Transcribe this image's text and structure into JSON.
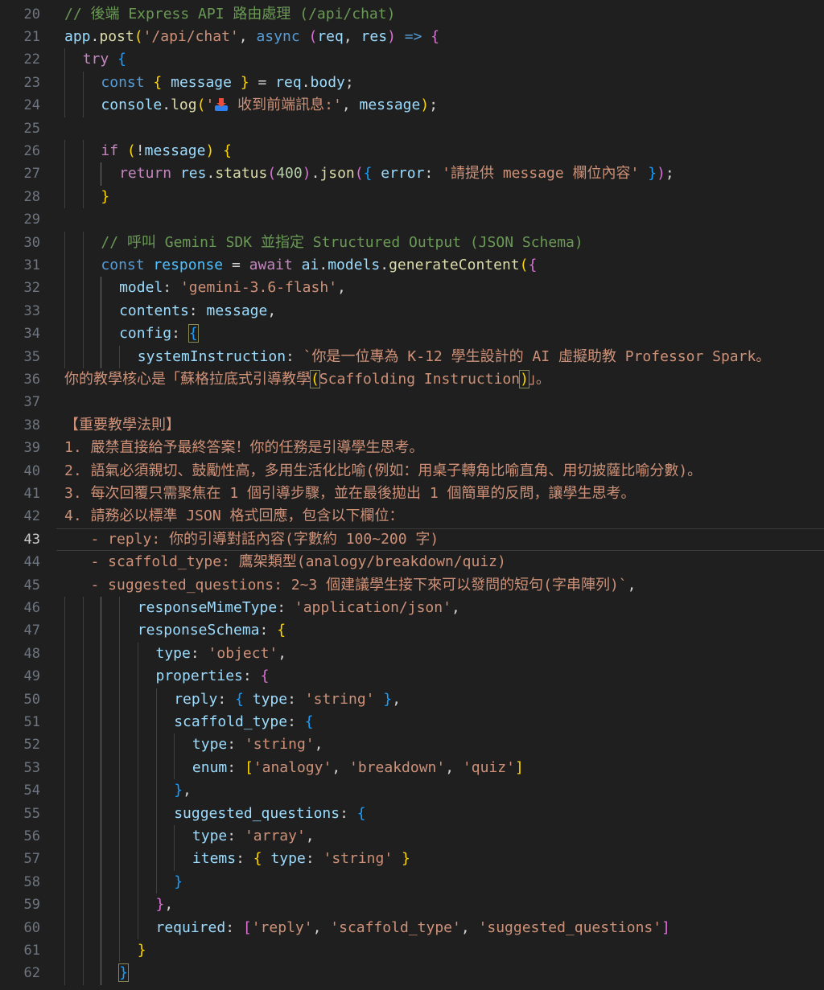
{
  "editor": {
    "theme": {
      "background": "#1f1f1f",
      "keyword": "#569cd6",
      "control": "#c586c0",
      "function": "#dcdcaa",
      "variable": "#9cdcfe",
      "string": "#ce9178",
      "number": "#b5cea8",
      "comment": "#6a9955",
      "bracket_level_1": "#ffd700",
      "bracket_level_2": "#da70d6",
      "bracket_level_3": "#179fff"
    },
    "current_line": 43,
    "lines": [
      {
        "n": 20,
        "indent": 0,
        "tokens": [
          [
            "com",
            "// 後端 Express API 路由處理 (/api/chat)"
          ]
        ]
      },
      {
        "n": 21,
        "indent": 0,
        "tokens": [
          [
            "var",
            "app"
          ],
          [
            "p",
            "."
          ],
          [
            "fn",
            "post"
          ],
          [
            "b1",
            "("
          ],
          [
            "str",
            "'/api/chat'"
          ],
          [
            "p",
            ", "
          ],
          [
            "kw",
            "async"
          ],
          [
            "p",
            " "
          ],
          [
            "b2",
            "("
          ],
          [
            "var",
            "req"
          ],
          [
            "p",
            ", "
          ],
          [
            "var",
            "res"
          ],
          [
            "b2",
            ")"
          ],
          [
            "p",
            " "
          ],
          [
            "kw",
            "=>"
          ],
          [
            "p",
            " "
          ],
          [
            "b2",
            "{"
          ]
        ]
      },
      {
        "n": 22,
        "indent": 1,
        "tokens": [
          [
            "ctl",
            "try"
          ],
          [
            "p",
            " "
          ],
          [
            "b3",
            "{"
          ]
        ]
      },
      {
        "n": 23,
        "indent": 2,
        "tokens": [
          [
            "kw",
            "const"
          ],
          [
            "p",
            " "
          ],
          [
            "b1",
            "{"
          ],
          [
            "p",
            " "
          ],
          [
            "var",
            "message"
          ],
          [
            "p",
            " "
          ],
          [
            "b1",
            "}"
          ],
          [
            "p",
            " = "
          ],
          [
            "var",
            "req"
          ],
          [
            "p",
            "."
          ],
          [
            "var",
            "body"
          ],
          [
            "p",
            ";"
          ]
        ]
      },
      {
        "n": 24,
        "indent": 2,
        "tokens": [
          [
            "var",
            "console"
          ],
          [
            "p",
            "."
          ],
          [
            "fn",
            "log"
          ],
          [
            "b1",
            "("
          ],
          [
            "str",
            "'"
          ],
          [
            "emoji",
            "inbox-tray-icon"
          ],
          [
            "str",
            " 收到前端訊息:'"
          ],
          [
            "p",
            ", "
          ],
          [
            "var",
            "message"
          ],
          [
            "b1",
            ")"
          ],
          [
            "p",
            ";"
          ]
        ]
      },
      {
        "n": 25,
        "indent": 0,
        "tokens": []
      },
      {
        "n": 26,
        "indent": 2,
        "tokens": [
          [
            "ctl",
            "if"
          ],
          [
            "p",
            " "
          ],
          [
            "b1",
            "("
          ],
          [
            "p",
            "!"
          ],
          [
            "var",
            "message"
          ],
          [
            "b1",
            ")"
          ],
          [
            "p",
            " "
          ],
          [
            "b1",
            "{"
          ]
        ]
      },
      {
        "n": 27,
        "indent": 3,
        "tokens": [
          [
            "ctl",
            "return"
          ],
          [
            "p",
            " "
          ],
          [
            "var",
            "res"
          ],
          [
            "p",
            "."
          ],
          [
            "fn",
            "status"
          ],
          [
            "b2",
            "("
          ],
          [
            "num",
            "400"
          ],
          [
            "b2",
            ")"
          ],
          [
            "p",
            "."
          ],
          [
            "fn",
            "json"
          ],
          [
            "b2",
            "("
          ],
          [
            "b3",
            "{"
          ],
          [
            "p",
            " "
          ],
          [
            "var",
            "error"
          ],
          [
            "p",
            ": "
          ],
          [
            "str",
            "'請提供 message 欄位內容'"
          ],
          [
            "p",
            " "
          ],
          [
            "b3",
            "}"
          ],
          [
            "b2",
            ")"
          ],
          [
            "p",
            ";"
          ]
        ]
      },
      {
        "n": 28,
        "indent": 2,
        "tokens": [
          [
            "b1",
            "}"
          ]
        ]
      },
      {
        "n": 29,
        "indent": 0,
        "tokens": []
      },
      {
        "n": 30,
        "indent": 2,
        "tokens": [
          [
            "com",
            "// 呼叫 Gemini SDK 並指定 Structured Output (JSON Schema)"
          ]
        ]
      },
      {
        "n": 31,
        "indent": 2,
        "tokens": [
          [
            "kw",
            "const"
          ],
          [
            "p",
            " "
          ],
          [
            "obj",
            "response"
          ],
          [
            "p",
            " = "
          ],
          [
            "ctl",
            "await"
          ],
          [
            "p",
            " "
          ],
          [
            "var",
            "ai"
          ],
          [
            "p",
            "."
          ],
          [
            "var",
            "models"
          ],
          [
            "p",
            "."
          ],
          [
            "fn",
            "generateContent"
          ],
          [
            "b1",
            "("
          ],
          [
            "b2",
            "{"
          ]
        ]
      },
      {
        "n": 32,
        "indent": 3,
        "tokens": [
          [
            "var",
            "model"
          ],
          [
            "p",
            ": "
          ],
          [
            "str",
            "'gemini-3.6-flash'"
          ],
          [
            "p",
            ","
          ]
        ]
      },
      {
        "n": 33,
        "indent": 3,
        "tokens": [
          [
            "var",
            "contents"
          ],
          [
            "p",
            ": "
          ],
          [
            "var",
            "message"
          ],
          [
            "p",
            ","
          ]
        ]
      },
      {
        "n": 34,
        "indent": 3,
        "tokens": [
          [
            "var",
            "config"
          ],
          [
            "p",
            ": "
          ],
          [
            "b3hl",
            "{"
          ]
        ]
      },
      {
        "n": 35,
        "indent": 4,
        "tokens": [
          [
            "var",
            "systemInstruction"
          ],
          [
            "p",
            ": "
          ],
          [
            "str",
            "`你是一位專為 K-12 學生設計的 AI 虛擬助教 Professor Spark。"
          ]
        ]
      },
      {
        "n": 36,
        "indent": 0,
        "tokens": [
          [
            "str",
            "你的教學核心是「蘇格拉底式引導教學"
          ],
          [
            "b1hl",
            "("
          ],
          [
            "str",
            "Scaffolding Instruction"
          ],
          [
            "b1hl",
            ")"
          ],
          [
            "str",
            "」。"
          ]
        ]
      },
      {
        "n": 37,
        "indent": 0,
        "tokens": []
      },
      {
        "n": 38,
        "indent": 0,
        "tokens": [
          [
            "str",
            "【重要教學法則】"
          ]
        ]
      },
      {
        "n": 39,
        "indent": 0,
        "tokens": [
          [
            "str",
            "1. 嚴禁直接給予最終答案！你的任務是引導學生思考。"
          ]
        ]
      },
      {
        "n": 40,
        "indent": 0,
        "tokens": [
          [
            "str",
            "2. 語氣必須親切、鼓勵性高，多用生活化比喻(例如：用桌子轉角比喻直角、用切披薩比喻分數)。"
          ]
        ]
      },
      {
        "n": 41,
        "indent": 0,
        "tokens": [
          [
            "str",
            "3. 每次回覆只需聚焦在 1 個引導步驟，並在最後拋出 1 個簡單的反問，讓學生思考。"
          ]
        ]
      },
      {
        "n": 42,
        "indent": 0,
        "tokens": [
          [
            "str",
            "4. 請務必以標準 JSON 格式回應，包含以下欄位："
          ]
        ]
      },
      {
        "n": 43,
        "indent": 0,
        "tokens": [
          [
            "str",
            "   - reply: 你的引導對話內容(字數約 100~200 字)"
          ]
        ]
      },
      {
        "n": 44,
        "indent": 0,
        "tokens": [
          [
            "str",
            "   - scaffold_type: 鷹架類型(analogy/breakdown/quiz)"
          ]
        ]
      },
      {
        "n": 45,
        "indent": 0,
        "tokens": [
          [
            "str",
            "   - suggested_questions: 2~3 個建議學生接下來可以發問的短句(字串陣列)`"
          ],
          [
            "p",
            ","
          ]
        ]
      },
      {
        "n": 46,
        "indent": 4,
        "tokens": [
          [
            "var",
            "responseMimeType"
          ],
          [
            "p",
            ": "
          ],
          [
            "str",
            "'application/json'"
          ],
          [
            "p",
            ","
          ]
        ]
      },
      {
        "n": 47,
        "indent": 4,
        "tokens": [
          [
            "var",
            "responseSchema"
          ],
          [
            "p",
            ": "
          ],
          [
            "b1",
            "{"
          ]
        ]
      },
      {
        "n": 48,
        "indent": 5,
        "tokens": [
          [
            "var",
            "type"
          ],
          [
            "p",
            ": "
          ],
          [
            "str",
            "'object'"
          ],
          [
            "p",
            ","
          ]
        ]
      },
      {
        "n": 49,
        "indent": 5,
        "tokens": [
          [
            "var",
            "properties"
          ],
          [
            "p",
            ": "
          ],
          [
            "b2",
            "{"
          ]
        ]
      },
      {
        "n": 50,
        "indent": 6,
        "tokens": [
          [
            "var",
            "reply"
          ],
          [
            "p",
            ": "
          ],
          [
            "b3",
            "{"
          ],
          [
            "p",
            " "
          ],
          [
            "var",
            "type"
          ],
          [
            "p",
            ": "
          ],
          [
            "str",
            "'string'"
          ],
          [
            "p",
            " "
          ],
          [
            "b3",
            "}"
          ],
          [
            "p",
            ","
          ]
        ]
      },
      {
        "n": 51,
        "indent": 6,
        "tokens": [
          [
            "var",
            "scaffold_type"
          ],
          [
            "p",
            ": "
          ],
          [
            "b3",
            "{"
          ]
        ]
      },
      {
        "n": 52,
        "indent": 7,
        "tokens": [
          [
            "var",
            "type"
          ],
          [
            "p",
            ": "
          ],
          [
            "str",
            "'string'"
          ],
          [
            "p",
            ","
          ]
        ]
      },
      {
        "n": 53,
        "indent": 7,
        "tokens": [
          [
            "var",
            "enum"
          ],
          [
            "p",
            ": "
          ],
          [
            "b1",
            "["
          ],
          [
            "str",
            "'analogy'"
          ],
          [
            "p",
            ", "
          ],
          [
            "str",
            "'breakdown'"
          ],
          [
            "p",
            ", "
          ],
          [
            "str",
            "'quiz'"
          ],
          [
            "b1",
            "]"
          ]
        ]
      },
      {
        "n": 54,
        "indent": 6,
        "tokens": [
          [
            "b3",
            "}"
          ],
          [
            "p",
            ","
          ]
        ]
      },
      {
        "n": 55,
        "indent": 6,
        "tokens": [
          [
            "var",
            "suggested_questions"
          ],
          [
            "p",
            ": "
          ],
          [
            "b3",
            "{"
          ]
        ]
      },
      {
        "n": 56,
        "indent": 7,
        "tokens": [
          [
            "var",
            "type"
          ],
          [
            "p",
            ": "
          ],
          [
            "str",
            "'array'"
          ],
          [
            "p",
            ","
          ]
        ]
      },
      {
        "n": 57,
        "indent": 7,
        "tokens": [
          [
            "var",
            "items"
          ],
          [
            "p",
            ": "
          ],
          [
            "b1",
            "{"
          ],
          [
            "p",
            " "
          ],
          [
            "var",
            "type"
          ],
          [
            "p",
            ": "
          ],
          [
            "str",
            "'string'"
          ],
          [
            "p",
            " "
          ],
          [
            "b1",
            "}"
          ]
        ]
      },
      {
        "n": 58,
        "indent": 6,
        "tokens": [
          [
            "b3",
            "}"
          ]
        ]
      },
      {
        "n": 59,
        "indent": 5,
        "tokens": [
          [
            "b2",
            "}"
          ],
          [
            "p",
            ","
          ]
        ]
      },
      {
        "n": 60,
        "indent": 5,
        "tokens": [
          [
            "var",
            "required"
          ],
          [
            "p",
            ": "
          ],
          [
            "b2",
            "["
          ],
          [
            "str",
            "'reply'"
          ],
          [
            "p",
            ", "
          ],
          [
            "str",
            "'scaffold_type'"
          ],
          [
            "p",
            ", "
          ],
          [
            "str",
            "'suggested_questions'"
          ],
          [
            "b2",
            "]"
          ]
        ]
      },
      {
        "n": 61,
        "indent": 4,
        "tokens": [
          [
            "b1",
            "}"
          ]
        ]
      },
      {
        "n": 62,
        "indent": 3,
        "tokens": [
          [
            "b3hl",
            "}"
          ]
        ]
      }
    ]
  }
}
